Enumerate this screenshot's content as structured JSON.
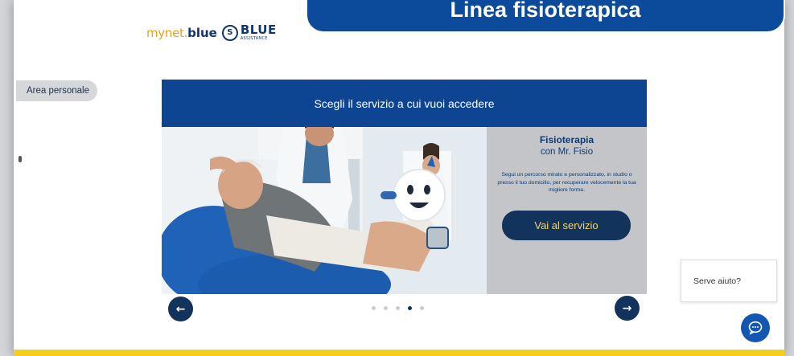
{
  "header": {
    "logo_mynet": "mynet.",
    "logo_blue_word": "blue",
    "logo_badge": "S",
    "logo_brand": "BLUE",
    "logo_brand_sub": "ASSISTANCE"
  },
  "banner": {
    "title": "Linea fisioterapica"
  },
  "sidebar": {
    "area_personale": "Area personale"
  },
  "service": {
    "header": "Scegli il servizio a cui vuoi accedere",
    "title": "Fisioterapia",
    "subtitle": "con Mr. Fisio",
    "description": "Segui un percorso mirato e personalizzato, in studio o presso il tuo domicilio, per recuperare velocemente la tua migliore forma.",
    "button_label": "Vai al servizio"
  },
  "carousel": {
    "prev_icon": "arrow-left-icon",
    "next_icon": "arrow-right-icon",
    "prev_glyph": "←",
    "next_glyph": "→",
    "slide_count": 5,
    "active_slide": 4
  },
  "help": {
    "label": "Serve aiuto?"
  },
  "colors": {
    "primary_blue": "#0d4592",
    "dark_navy": "#12335c",
    "accent_yellow": "#f3cf1c",
    "brand_orange": "#e8a21a",
    "chat_blue": "#1457b3"
  }
}
